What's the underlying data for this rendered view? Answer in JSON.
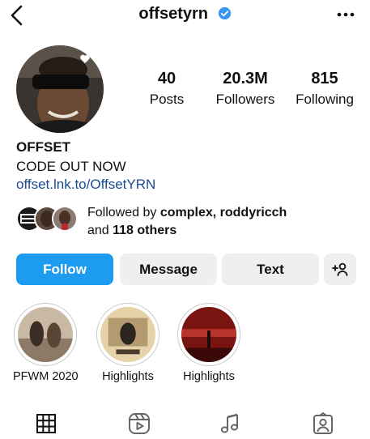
{
  "header": {
    "username": "offsetyrn",
    "back_icon": "chevron-left-icon",
    "verified_icon": "verified-badge-icon",
    "more_icon": "more-horizontal-icon"
  },
  "profile": {
    "stats": [
      {
        "value": "40",
        "label": "Posts"
      },
      {
        "value": "20.3M",
        "label": "Followers"
      },
      {
        "value": "815",
        "label": "Following"
      }
    ],
    "name": "OFFSET",
    "bio": "CODE OUT NOW",
    "link": "offset.lnk.to/OffsetYRN"
  },
  "followed_by": {
    "prefix": "Followed by ",
    "user1": "complex",
    "separator": ", ",
    "user2": "roddyricch",
    "and": "and ",
    "others": "118 others"
  },
  "actions": {
    "follow": "Follow",
    "message": "Message",
    "text": "Text",
    "add_person_icon": "add-person-icon"
  },
  "highlights": [
    {
      "label": "PFWM 2020"
    },
    {
      "label": "Highlights"
    },
    {
      "label": "Highlights"
    }
  ],
  "tabs": [
    {
      "icon": "grid-icon"
    },
    {
      "icon": "reels-icon"
    },
    {
      "icon": "music-note-icon"
    },
    {
      "icon": "tagged-user-icon"
    }
  ],
  "colors": {
    "follow_button": "#1d9bf0",
    "secondary_button": "#efefef",
    "link": "#1a4b8f",
    "verified": "#3897f0"
  }
}
